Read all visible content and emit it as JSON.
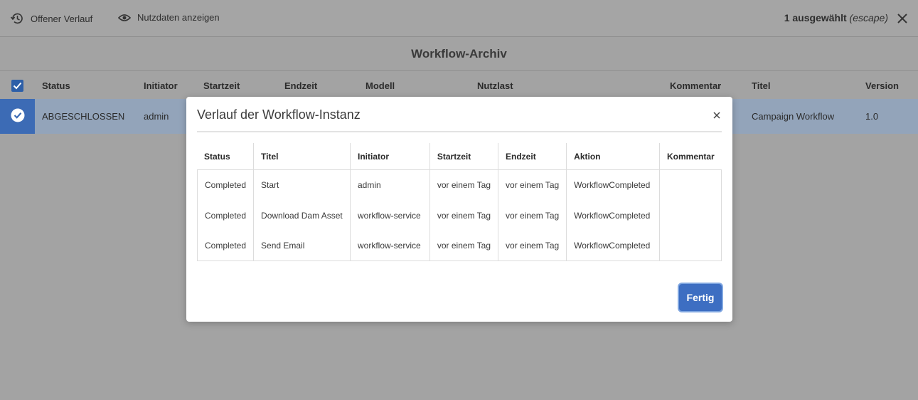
{
  "toolbar": {
    "history_label": "Offener Verlauf",
    "payload_label": "Nutzdaten anzeigen",
    "selection_count": "1 ausgewählt",
    "selection_hint": "(escape)"
  },
  "page": {
    "title": "Workflow-Archiv"
  },
  "archive_table": {
    "headers": {
      "status": "Status",
      "initiator": "Initiator",
      "start": "Startzeit",
      "end": "Endzeit",
      "model": "Modell",
      "payload": "Nutzlast",
      "comment": "Kommentar",
      "title": "Titel",
      "version": "Version"
    },
    "rows": [
      {
        "status": "ABGESCHLOSSEN",
        "initiator": "admin",
        "title": "Campaign Workflow",
        "version": "1.0"
      }
    ]
  },
  "modal": {
    "title": "Verlauf der Workflow-Instanz",
    "columns": [
      "Status",
      "Titel",
      "Initiator",
      "Startzeit",
      "Endzeit",
      "Aktion",
      "Kommentar"
    ],
    "rows": [
      [
        "Completed",
        "Start",
        "admin",
        "vor einem Tag",
        "vor einem Tag",
        "WorkflowCompleted",
        ""
      ],
      [
        "Completed",
        "Download Dam Asset",
        "workflow-service",
        "vor einem Tag",
        "vor einem Tag",
        "WorkflowCompleted",
        ""
      ],
      [
        "Completed",
        "Send Email",
        "workflow-service",
        "vor einem Tag",
        "vor einem Tag",
        "WorkflowCompleted",
        ""
      ]
    ],
    "done_label": "Fertig"
  },
  "colors": {
    "accent": "#3d6ec2",
    "overlay_bg": "#a3a3a3",
    "selected_row": "#93a4ba"
  },
  "icons": {
    "history": "history-icon",
    "payload": "eye-icon",
    "close": "close-icon",
    "check": "checkmark-icon"
  }
}
